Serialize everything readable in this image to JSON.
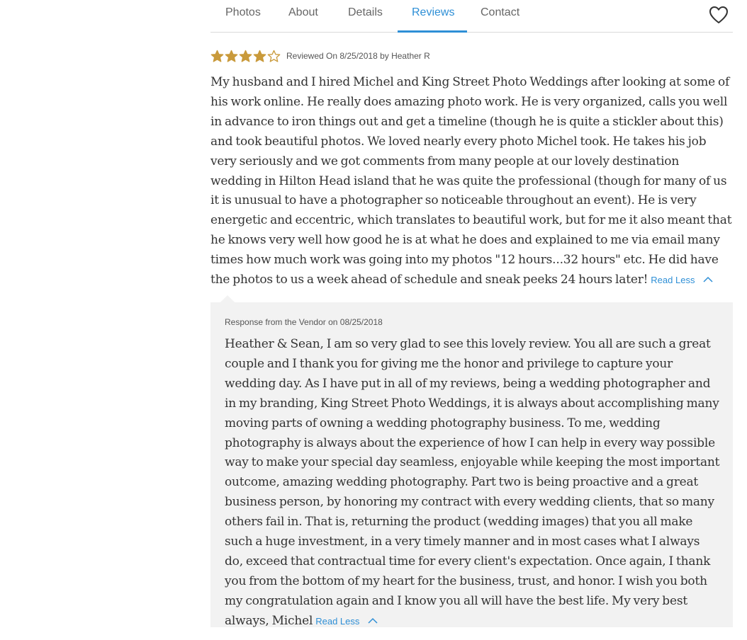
{
  "tabs": {
    "photos": "Photos",
    "about": "About",
    "details": "Details",
    "reviews": "Reviews",
    "contact": "Contact",
    "active": "Reviews"
  },
  "favorite_icon": "heart-outline-icon",
  "colors": {
    "accent": "#2e8fd6",
    "star": "#c99a3b",
    "response_bg": "#f2f2f2"
  },
  "review": {
    "rating": 4,
    "rating_max": 5,
    "meta": "Reviewed On 8/25/2018 by Heather R",
    "text": "My husband and I hired Michel and King Street Photo Weddings after looking at some of his work online. He really does amazing photo work. He is very organized, calls you well in advance to iron things out and get a timeline (though he is quite a stickler about this) and took beautiful photos. We loved nearly every photo Michel took. He takes his job very seriously and we got comments from many people at our lovely destination wedding in Hilton Head island that he was quite the professional (though for many of us it is unusual to have a photographer so noticeable throughout an event). He is very energetic and eccentric, which translates to beautiful work, but for me it also meant that he knows very well how good he is at what he does and explained to me via email many times how much work was going into my photos \"12 hours...32 hours\" etc. He did have the photos to us a week ahead of schedule and sneak peeks 24 hours later!",
    "read_less": "Read Less"
  },
  "response": {
    "meta": "Response from the Vendor on 08/25/2018",
    "text": "Heather & Sean, I am so very glad to see this lovely review. You all are such a great couple and I thank you for giving me the honor and privilege to capture your wedding day. As I have put in all of my reviews, being a wedding photographer and in my branding, King Street Photo Weddings, it is always about accomplishing many moving parts of owning a wedding photography business. To me, wedding photography is always about the experience of how I can help in every way possible way to make your special day seamless, enjoyable while keeping the most important outcome, amazing wedding photography. Part two is being proactive and a great business person, by honoring my contract with every wedding clients, that so many others fail in. That is, returning the product (wedding images) that you all make such a huge investment, in a very timely manner and in most cases what I always do, exceed that contractual time for every client's expectation. Once again, I thank you from the bottom of my heart for the business, trust, and honor. I wish you both my congratulation again and I know you all will have the best life. My very best always, Michel",
    "read_less": "Read Less"
  }
}
